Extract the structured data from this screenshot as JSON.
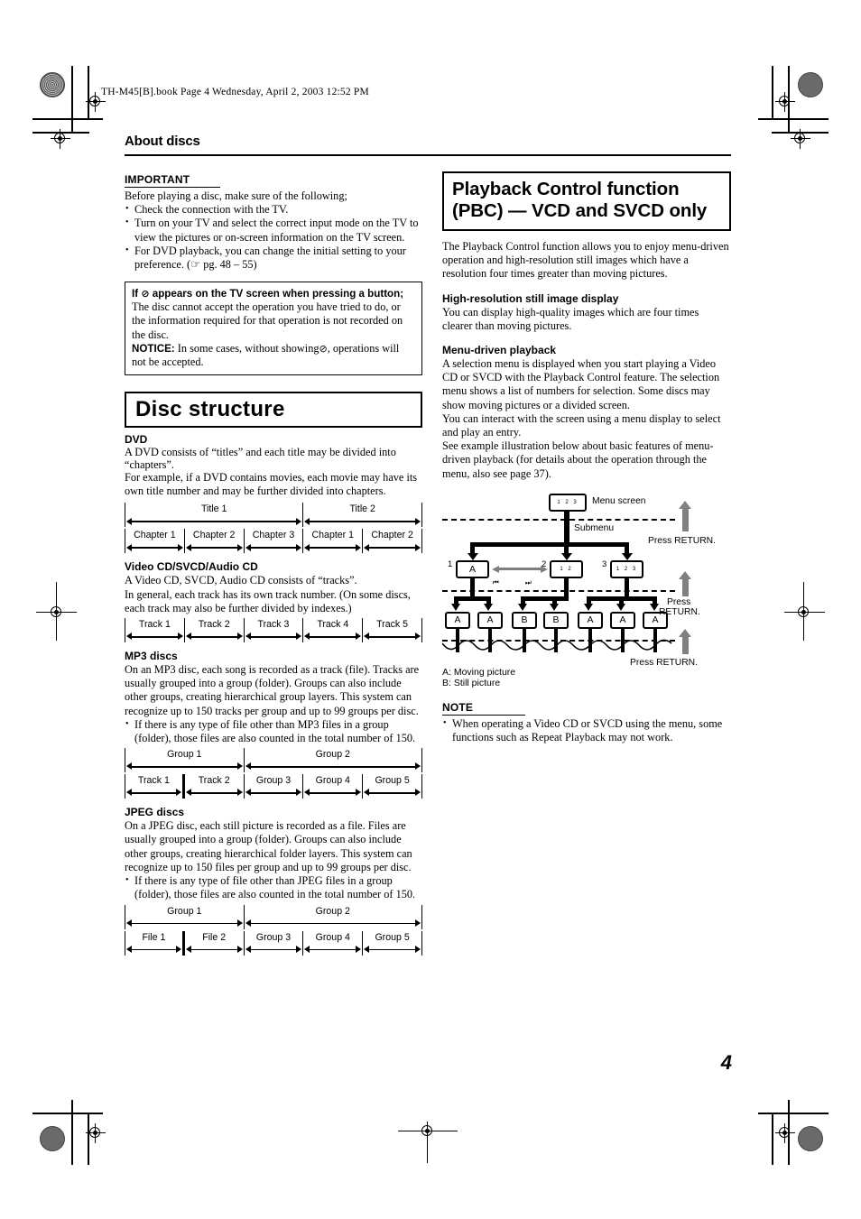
{
  "file_header": "TH-M45[B].book  Page 4  Wednesday, April 2, 2003  12:52 PM",
  "page_title": "About discs",
  "page_number": "4",
  "left": {
    "important": {
      "heading": "IMPORTANT",
      "intro": "Before playing a disc, make sure of the following;",
      "bullets": [
        "Check the connection with the TV.",
        "Turn on your TV and select the correct input mode on the TV to view the pictures or on-screen information on the TV screen.",
        "For DVD playback, you can change the initial setting to your preference. (☞ pg. 48 – 55)"
      ]
    },
    "notice_box": {
      "heading_prefix": "If",
      "heading_symbol": "⊘",
      "heading_suffix": "appears on the TV screen when pressing a button;",
      "body": "The disc cannot accept the operation you have tried to do, or the information required for that operation is not recorded on the disc.",
      "notice_label": "NOTICE:",
      "notice_text_before": "In some cases, without showing",
      "notice_symbol": "⊘",
      "notice_text_after": ", operations will not be accepted."
    },
    "section_title": "Disc structure",
    "dvd": {
      "heading": "DVD",
      "text1": "A DVD consists of “titles” and each title may be divided into “chapters”.",
      "text2": "For example, if a DVD contains movies, each movie may have its own title number and may be further divided into chapters.",
      "row_titles": [
        "Title 1",
        "Title 2"
      ],
      "row_titles_widths": [
        60,
        40
      ],
      "row_chapters": [
        "Chapter 1",
        "Chapter 2",
        "Chapter 3",
        "Chapter 1",
        "Chapter 2"
      ],
      "row_chapters_widths": [
        20,
        20,
        20,
        20,
        20
      ]
    },
    "cd": {
      "heading": "Video CD/SVCD/Audio CD",
      "text1": "A Video CD, SVCD, Audio CD consists of “tracks”.",
      "text2": "In general, each track has its own track number. (On some discs, each track may also be further divided by indexes.)",
      "row_tracks": [
        "Track 1",
        "Track 2",
        "Track 3",
        "Track 4",
        "Track 5"
      ],
      "row_tracks_widths": [
        20,
        20,
        20,
        20,
        20
      ]
    },
    "mp3": {
      "heading": "MP3 discs",
      "text1": "On an MP3 disc, each song is recorded as a track (file). Tracks are usually grouped into a group (folder). Groups can also include other groups, creating hierarchical group layers. This system can recognize up to 150 tracks per group and up to 99 groups per disc.",
      "bullet": "If there is any type of file other than MP3 files in a group (folder), those files are also counted in the total number of 150.",
      "row_groups": [
        "Group 1",
        "Group 2"
      ],
      "row_groups_widths": [
        40,
        60
      ],
      "row_items": [
        "Track 1",
        "Track 2",
        "Group 3",
        "Group 4",
        "Group 5"
      ],
      "row_items_widths": [
        20,
        20,
        20,
        20,
        20
      ]
    },
    "jpeg": {
      "heading": "JPEG discs",
      "text1": "On a JPEG disc, each still picture is recorded as a file. Files are usually grouped into a group (folder). Groups can also include other groups, creating hierarchical folder layers. This system can recognize up to 150 files per group and up to 99 groups per disc.",
      "bullet": "If there is any type of file other than JPEG files in a group (folder), those files are also counted in the total number of 150.",
      "row_groups": [
        "Group 1",
        "Group 2"
      ],
      "row_groups_widths": [
        40,
        60
      ],
      "row_items": [
        "File 1",
        "File 2",
        "Group 3",
        "Group 4",
        "Group 5"
      ],
      "row_items_widths": [
        20,
        20,
        20,
        20,
        20
      ]
    }
  },
  "right": {
    "section_title": "Playback Control function (PBC) — VCD and SVCD only",
    "intro": "The Playback Control function allows you to enjoy menu-driven operation and high-resolution still images which have a resolution four times greater than moving pictures.",
    "hires": {
      "heading": "High-resolution still image display",
      "text": "You can display high-quality images which are four times clearer than moving pictures."
    },
    "menu_driven": {
      "heading": "Menu-driven playback",
      "text1": "A selection menu is displayed when you start playing a Video CD or SVCD with the Playback Control feature. The selection menu shows a list of numbers for selection. Some discs may show moving pictures or a divided screen.",
      "text2": "You can interact with the screen using a menu display to select and play an entry.",
      "text3": "See example illustration below about basic features of menu-driven playback (for details about the operation through the menu, also see page 37)."
    },
    "diagram": {
      "menu_screen_label": "Menu screen",
      "submenu_label": "Submenu",
      "press_return_1": "Press RETURN.",
      "press_return_2_line1": "Press",
      "press_return_2_line2": "RETURN.",
      "press_return_3_line1": "Press",
      "press_return_3_line2": "RETURN.",
      "press_return_4": "Press RETURN.",
      "menu_node": "1 2 3",
      "level2_numbers": [
        "1",
        "2",
        "3"
      ],
      "level2_nodes": [
        "A",
        "1 2",
        "1 2 3"
      ],
      "level3_nodes": [
        "A",
        "A",
        "B",
        "B",
        "A",
        "A",
        "A"
      ],
      "skip_back_icon": "⏮",
      "skip_fwd_icon": "⏭",
      "legend_a": "A: Moving picture",
      "legend_b": "B: Still picture"
    },
    "note": {
      "heading": "NOTE",
      "bullet": "When operating a Video CD or SVCD using the menu, some functions such as Repeat Playback may not work."
    }
  }
}
